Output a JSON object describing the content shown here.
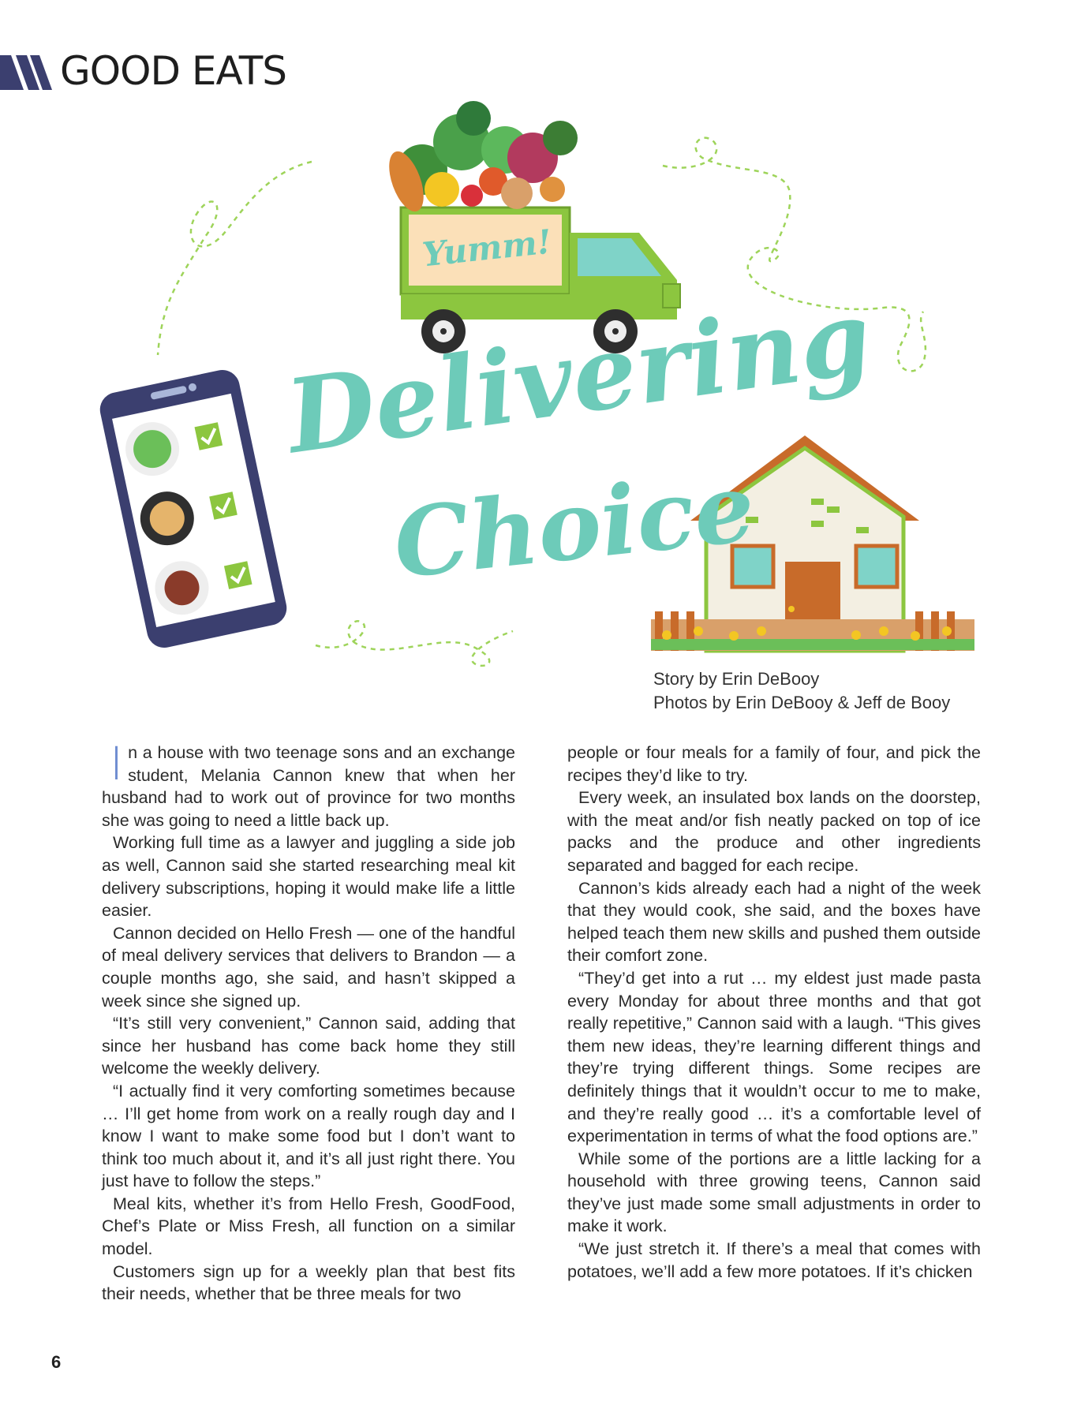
{
  "header": {
    "section": "GOOD EATS"
  },
  "illustration": {
    "title_line1": "Delivering",
    "title_line2": "Choice",
    "truck_sign": "Yumm!",
    "colors": {
      "accent": "#6dcbb9",
      "truck": "#8cc63f",
      "phone": "#3b3f6f",
      "house_roof": "#c86b2a"
    }
  },
  "credits": {
    "story": "Story by Erin DeBooy",
    "photos": "Photos by Erin DeBooy & Jeff de Booy"
  },
  "article": {
    "dropcap": "I",
    "col1": [
      "n a house with two teenage sons and an exchange student, Melania Cannon knew that when her husband had to work out of province for two months she was going to need a little back up.",
      "Working full time as a lawyer and juggling a side job as well, Cannon said she started researching meal kit delivery subscriptions, hoping it would make life a little easier.",
      "Cannon decided on Hello Fresh — one of the handful of meal delivery services that delivers to Brandon — a couple months ago, she said, and hasn’t skipped a week since she signed up.",
      "“It’s still very convenient,” Cannon said, adding that since her husband has come back home they still welcome the weekly delivery.",
      "“I actually find it very comforting sometimes because … I’ll get home from work on a really rough day and I know I want to make some food but I don’t want to think too much about it, and it’s all just right there. You just have to follow the steps.”",
      "Meal kits, whether it’s from Hello Fresh, GoodFood, Chef’s Plate or Miss Fresh, all function on a similar model.",
      "Customers sign up for a weekly plan that best fits their needs, whether that be three meals for two"
    ],
    "col2": [
      "people or four meals for a family of four, and pick the recipes they’d like to try.",
      "Every week, an insulated box lands on the doorstep, with the meat and/or fish neatly packed on top of ice packs and the produce and other ingredients separated and bagged for each recipe.",
      "Cannon’s kids already each had a night of the week that they would cook, she said, and the boxes have helped teach them new skills and pushed them outside their comfort zone.",
      "“They’d get into a rut … my eldest just made pasta every Monday for about three months and that got really repetitive,” Cannon said with a laugh. “This gives them new ideas, they’re learning different things and they’re trying different things. Some recipes are definitely things that it wouldn’t occur to me to make, and they’re really good … it’s a comfortable level of experimentation in terms of what the food options are.”",
      "While some of the portions are a little lacking for a household with three growing teens, Cannon said they’ve just made some small adjustments in order to make it work.",
      "“We just stretch it. If there’s a meal that comes with potatoes, we’ll add a few more potatoes. If it’s chicken"
    ]
  },
  "page_number": "6"
}
